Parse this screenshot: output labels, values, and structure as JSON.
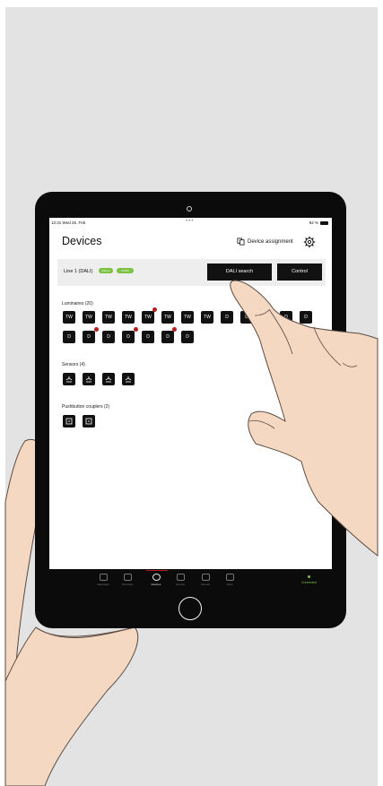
{
  "statusbar": {
    "time": "12:31",
    "date": "Wed 26. Feb",
    "battery": "92 %"
  },
  "header": {
    "title": "Devices",
    "assign_label": "Device assignment"
  },
  "line": {
    "label": "Line 1 (DALI)",
    "badge1": "DALI-2",
    "badge2": "DT6/8",
    "dali_search": "DALI search",
    "control": "Control"
  },
  "luminaires": {
    "label": "Luminaires (20)",
    "row1": [
      "TW",
      "TW",
      "TW",
      "TW",
      "TW",
      "TW",
      "TW",
      "TW",
      "D",
      "D",
      "D",
      "D",
      "D"
    ],
    "row2": [
      "D",
      "D",
      "D",
      "D",
      "D",
      "D",
      "D"
    ]
  },
  "sensors": {
    "label": "Sensors (4)"
  },
  "pushbuttons": {
    "label": "Pushbutton couplers (2)"
  },
  "tabs": [
    "Gateways",
    "Structure",
    "Devices",
    "Groups",
    "Scenes",
    "Apps"
  ],
  "connection": "Connected",
  "colors": {
    "accent_green": "#7bc142",
    "alert_red": "#b71b1b",
    "tile": "#111111"
  }
}
